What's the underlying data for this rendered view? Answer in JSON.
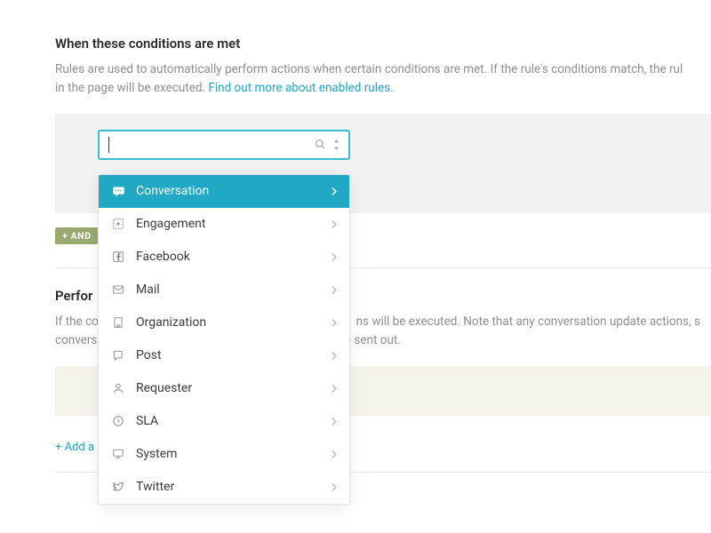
{
  "conditions": {
    "title": "When these conditions are met",
    "desc_part1": "Rules are used to automatically perform actions when certain conditions are met. If the rule's conditions match, the rul",
    "desc_part2": "in the page will be executed. ",
    "desc_link": "Find out more about enabled rules."
  },
  "and_badge": "+ AND",
  "search": {
    "value": ""
  },
  "dropdown": {
    "items": [
      {
        "label": "Conversation",
        "icon": "chat"
      },
      {
        "label": "Engagement",
        "icon": "plus-box"
      },
      {
        "label": "Facebook",
        "icon": "facebook"
      },
      {
        "label": "Mail",
        "icon": "mail"
      },
      {
        "label": "Organization",
        "icon": "building"
      },
      {
        "label": "Post",
        "icon": "post"
      },
      {
        "label": "Requester",
        "icon": "person"
      },
      {
        "label": "SLA",
        "icon": "clock"
      },
      {
        "label": "System",
        "icon": "monitor"
      },
      {
        "label": "Twitter",
        "icon": "twitter"
      }
    ]
  },
  "actions": {
    "title_visible": "Perfor",
    "desc_line1_a": "If the co",
    "desc_line1_b": "ns will be executed. Note that any conversation update actions, s",
    "desc_line2_a": "convers",
    "desc_line2_b": "are sent out."
  },
  "add_action": "+ Add a"
}
